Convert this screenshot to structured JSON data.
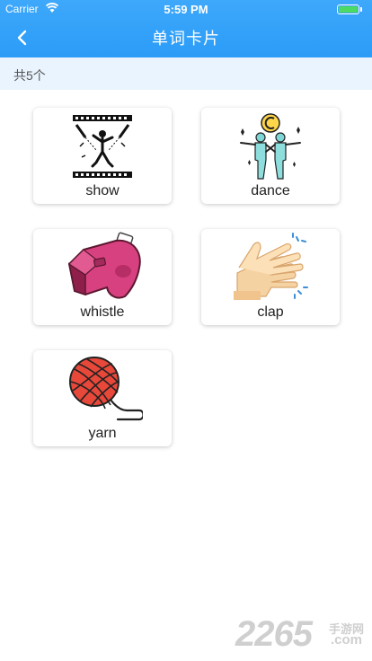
{
  "status_bar": {
    "carrier": "Carrier",
    "time": "5:59 PM"
  },
  "header": {
    "title": "单词卡片",
    "back_icon": "chevron-left-icon"
  },
  "count": "共5个",
  "cards": [
    {
      "word": "show",
      "icon": "show-stage-icon"
    },
    {
      "word": "dance",
      "icon": "dancers-icon"
    },
    {
      "word": "whistle",
      "icon": "whistle-icon"
    },
    {
      "word": "clap",
      "icon": "clapping-hands-icon"
    },
    {
      "word": "yarn",
      "icon": "yarn-ball-icon"
    }
  ],
  "watermark": {
    "number": "2265",
    "brand": "手游网",
    "domain": ".com"
  },
  "colors": {
    "header": "#2b9cf7",
    "count_bar": "#e9f4fe",
    "battery": "#4cd964"
  }
}
